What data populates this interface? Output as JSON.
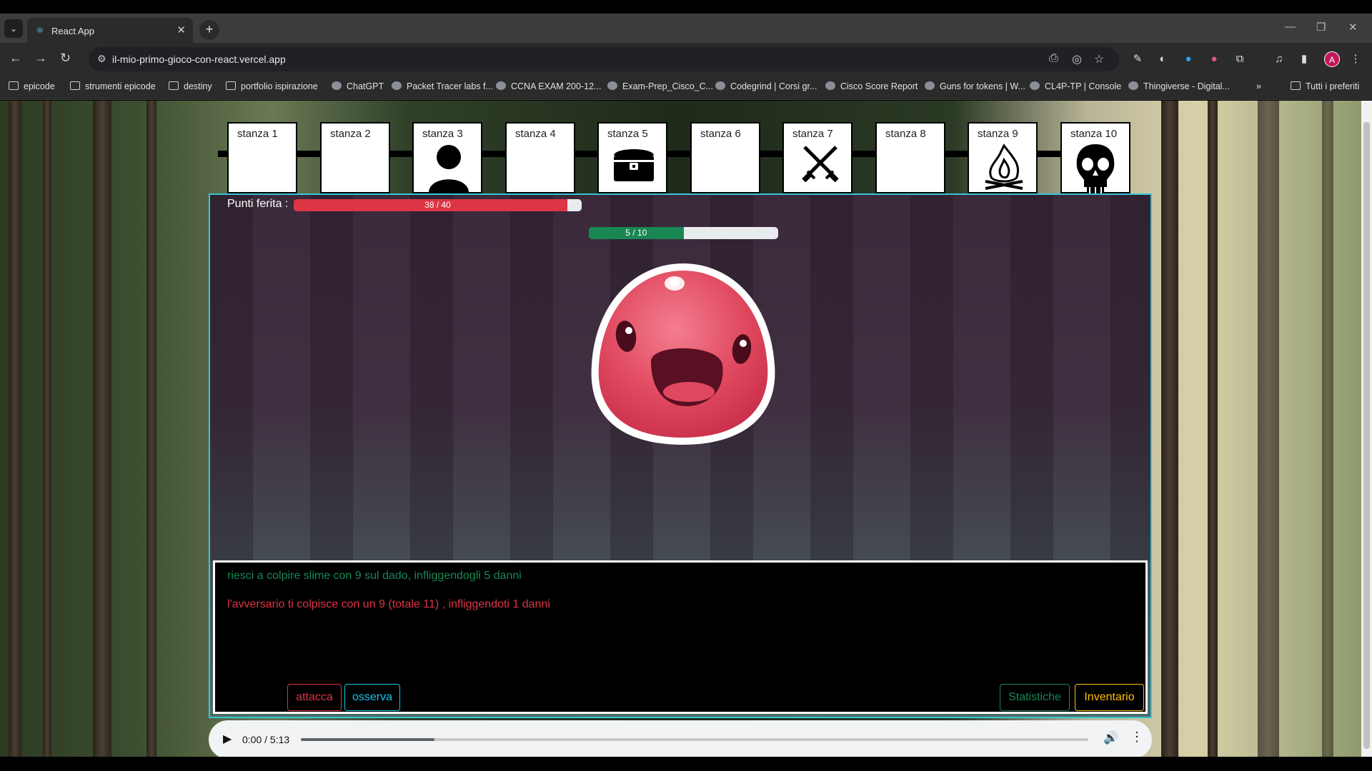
{
  "browser": {
    "tab_title": "React App",
    "url": "il-mio-primo-gioco-con-react.vercel.app",
    "bookmarks": [
      {
        "label": "epicode",
        "icon": "folder-icon"
      },
      {
        "label": "strumenti epicode",
        "icon": "folder-icon"
      },
      {
        "label": "destiny",
        "icon": "folder-icon"
      },
      {
        "label": "portfolio ispirazione",
        "icon": "folder-icon"
      },
      {
        "label": "ChatGPT",
        "icon": "chatgpt-icon"
      },
      {
        "label": "Packet Tracer labs f...",
        "icon": "site-icon"
      },
      {
        "label": "CCNA EXAM 200-12...",
        "icon": "site-icon"
      },
      {
        "label": "Exam-Prep_Cisco_C...",
        "icon": "site-icon"
      },
      {
        "label": "Codegrind | Corsi gr...",
        "icon": "site-icon"
      },
      {
        "label": "Cisco Score Report",
        "icon": "site-icon"
      },
      {
        "label": "Guns for tokens | W...",
        "icon": "site-icon"
      },
      {
        "label": "CL4P-TP | Console",
        "icon": "site-icon"
      },
      {
        "label": "Thingiverse - Digital...",
        "icon": "site-icon"
      },
      {
        "label": "Tutti i preferiti",
        "icon": "folder-icon"
      }
    ],
    "avatar_letter": "A"
  },
  "rooms": [
    {
      "label": "stanza 1",
      "icon": ""
    },
    {
      "label": "stanza 2",
      "icon": ""
    },
    {
      "label": "stanza 3",
      "icon": "player-icon"
    },
    {
      "label": "stanza 4",
      "icon": ""
    },
    {
      "label": "stanza 5",
      "icon": "treasure-chest-icon"
    },
    {
      "label": "stanza 6",
      "icon": ""
    },
    {
      "label": "stanza 7",
      "icon": "crossed-swords-icon"
    },
    {
      "label": "stanza 8",
      "icon": ""
    },
    {
      "label": "stanza 9",
      "icon": "campfire-icon"
    },
    {
      "label": "stanza 10",
      "icon": "skull-icon"
    }
  ],
  "player": {
    "hp_label": "Punti ferita :",
    "hp_current": 38,
    "hp_max": 40,
    "hp_text": "38 / 40"
  },
  "enemy": {
    "name": "slime",
    "hp_current": 5,
    "hp_max": 10,
    "hp_text": "5 / 10"
  },
  "log": [
    {
      "text": "riesci a colpire slime con 9 sul dado, infliggendogli 5 danni",
      "color": "#198754"
    },
    {
      "text": "l'avversario ti colpisce con un 9 (totale 11) , infliggendoti 1 danni",
      "color": "#dc3545"
    }
  ],
  "actions": {
    "attack": "attacca",
    "observe": "osserva",
    "stats": "Statistiche",
    "inventory": "Inventario"
  },
  "colors": {
    "attack": "#dc3545",
    "observe": "#0dcaf0",
    "stats": "#198754",
    "inventory": "#ffc107",
    "panel_border": "#36c7d8"
  },
  "audio": {
    "time": "0:00 / 5:13",
    "progress": 0.17
  }
}
